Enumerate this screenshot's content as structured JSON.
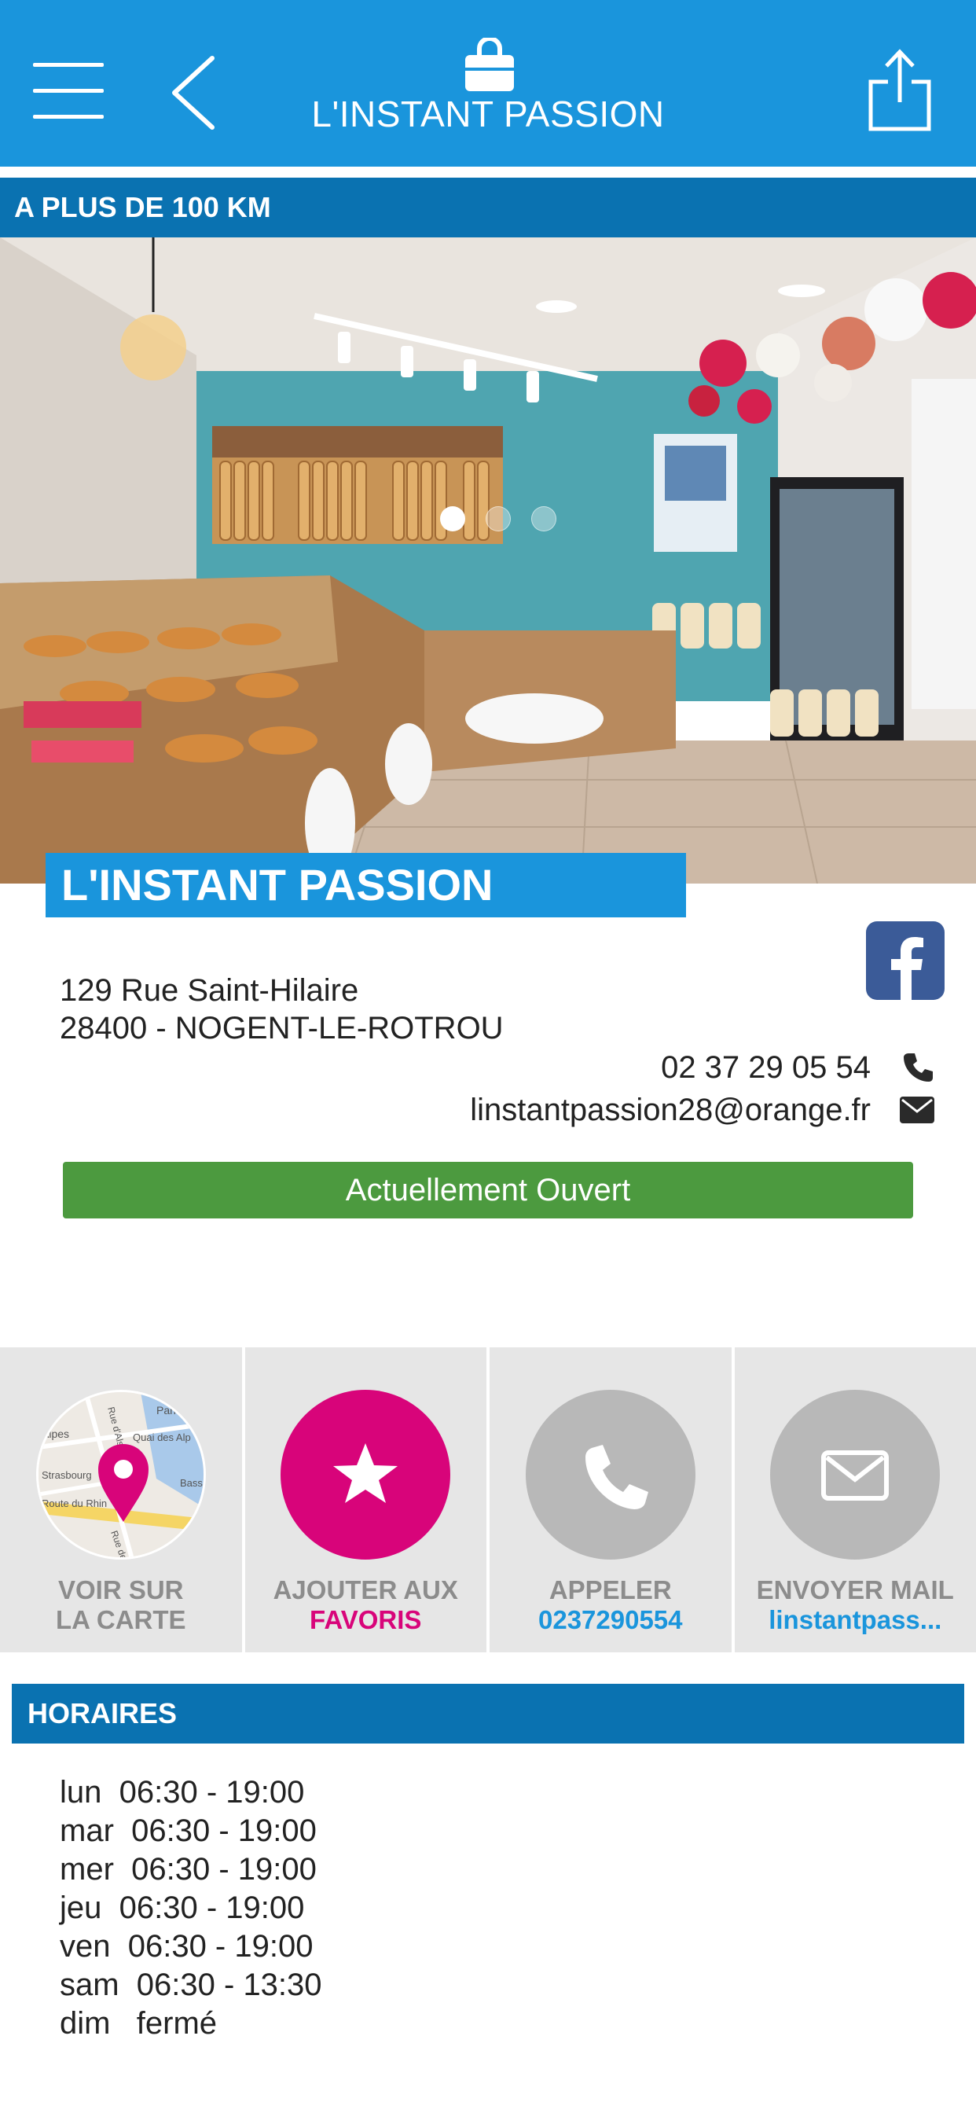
{
  "header": {
    "title": "L'INSTANT PASSION",
    "menu_icon": "hamburger-menu-icon",
    "back_icon": "chevron-left-icon",
    "logo_icon": "shopping-bag-icon",
    "share_icon": "share-icon"
  },
  "distance": "A PLUS DE 100 KM",
  "carousel": {
    "slides": 3,
    "active": 1
  },
  "shop": {
    "name": "L'INSTANT PASSION",
    "address_line1": "129 Rue Saint-Hilaire",
    "address_line2": "28400 - NOGENT-LE-ROTROU",
    "phone": "02 37 29 05 54",
    "email": "linstantpassion28@orange.fr",
    "status": "Actuellement Ouvert"
  },
  "actions": [
    {
      "line1": "VOIR SUR",
      "line2": "LA CARTE",
      "icon": "map-pin-icon"
    },
    {
      "line1": "AJOUTER AUX",
      "line2": "FAVORIS",
      "icon": "star-icon"
    },
    {
      "line1": "APPELER",
      "line2": "0237290554",
      "icon": "phone-icon"
    },
    {
      "line1": "ENVOYER MAIL",
      "line2": "linstantpass...",
      "icon": "envelope-icon"
    }
  ],
  "hours": {
    "title": "HORAIRES",
    "rows": [
      "lun  06:30 - 19:00",
      "mar  06:30 - 19:00",
      "mer  06:30 - 19:00",
      "jeu  06:30 - 19:00",
      "ven  06:30 - 19:00",
      "sam  06:30 - 13:30",
      "dim   fermé"
    ]
  },
  "map_labels": [
    "Paris",
    "Alpes",
    "Strasbourg",
    "Quai des Alp",
    "Route du Rhin",
    "Bass",
    "Rue d'Alsa",
    "Rue de M"
  ],
  "colors": {
    "primary": "#1a95dc",
    "dark_blue": "#0a72b1",
    "open_green": "#4c9a3f",
    "favorite_pink": "#d8047a",
    "facebook": "#3b5b98",
    "tile_bg": "#e6e6e6"
  }
}
